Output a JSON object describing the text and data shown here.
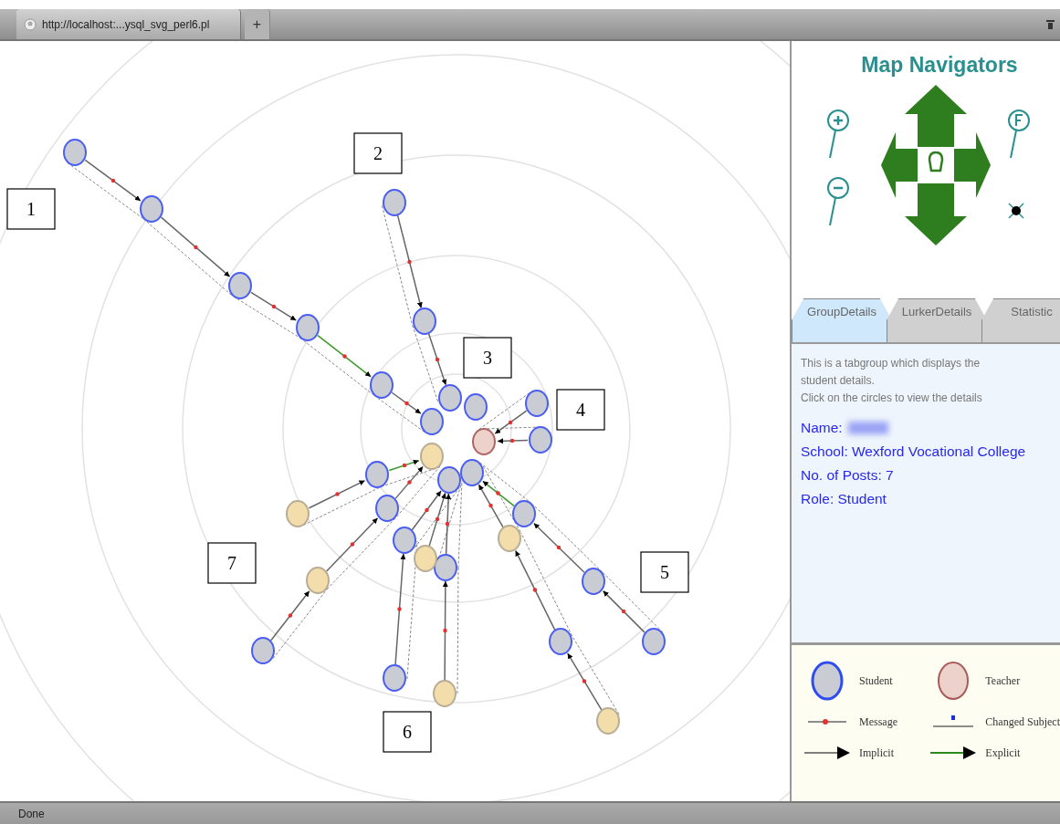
{
  "browser": {
    "tab_title": "http://localhost:...ysql_svg_perl6.pl",
    "new_tab": "+"
  },
  "map": {
    "nodes": [
      {
        "kind": "student"
      },
      {
        "kind": "student"
      },
      {
        "kind": "student"
      },
      {
        "kind": "student"
      },
      {
        "kind": "student"
      },
      {
        "kind": "student"
      },
      {
        "kind": "student"
      },
      {
        "kind": "student"
      },
      {
        "kind": "student"
      },
      {
        "kind": "student"
      },
      {
        "kind": "teacher"
      },
      {
        "kind": "student"
      },
      {
        "kind": "student"
      },
      {
        "kind": "other"
      },
      {
        "kind": "student"
      },
      {
        "kind": "student"
      },
      {
        "kind": "other"
      },
      {
        "kind": "student"
      },
      {
        "kind": "student"
      },
      {
        "kind": "student"
      },
      {
        "kind": "other"
      },
      {
        "kind": "student"
      },
      {
        "kind": "student"
      },
      {
        "kind": "student"
      },
      {
        "kind": "other"
      },
      {
        "kind": "student"
      },
      {
        "kind": "other"
      },
      {
        "kind": "student"
      },
      {
        "kind": "student"
      },
      {
        "kind": "other"
      },
      {
        "kind": "other"
      },
      {
        "kind": "student"
      }
    ],
    "edges": [
      {
        "kind": "implicit"
      },
      {
        "kind": "implicit"
      },
      {
        "kind": "implicit"
      },
      {
        "kind": "explicit"
      },
      {
        "kind": "implicit"
      },
      {
        "kind": "implicit"
      },
      {
        "kind": "implicit"
      },
      {
        "kind": "implicit"
      },
      {
        "kind": "implicit"
      },
      {
        "kind": "explicit"
      },
      {
        "kind": "implicit"
      },
      {
        "kind": "implicit"
      },
      {
        "kind": "implicit"
      },
      {
        "kind": "implicit"
      },
      {
        "kind": "implicit"
      },
      {
        "kind": "implicit"
      },
      {
        "kind": "implicit"
      },
      {
        "kind": "implicit"
      },
      {
        "kind": "implicit"
      },
      {
        "kind": "implicit"
      },
      {
        "kind": "explicit"
      },
      {
        "kind": "implicit"
      },
      {
        "kind": "implicit"
      },
      {
        "kind": "implicit"
      },
      {
        "kind": "implicit"
      }
    ],
    "labels": [
      "1",
      "2",
      "3",
      "4",
      "5",
      "6",
      "7"
    ]
  },
  "panel": {
    "title": "Map Navigators",
    "tabs": [
      {
        "label": "GroupDetails",
        "selected": true
      },
      {
        "label": "LurkerDetails",
        "selected": false
      },
      {
        "label": "Statistic",
        "selected": false
      }
    ],
    "description": [
      "This is a tabgroup which displays the",
      "student details.",
      "Click on the circles to view the details"
    ],
    "details": [
      {
        "text": "Name:",
        "redacted": true
      },
      {
        "text": "School: Wexford Vocational College",
        "redacted": false
      },
      {
        "text": "No. of Posts: 7",
        "redacted": false
      },
      {
        "text": "Role: Student",
        "redacted": false
      }
    ],
    "legend": [
      {
        "kind": "student",
        "label": "Student"
      },
      {
        "kind": "teacher",
        "label": "Teacher"
      },
      {
        "kind": "message",
        "label": "Message"
      },
      {
        "kind": "changed_subject",
        "label": "Changed Subject"
      },
      {
        "kind": "implicit",
        "label": "Implicit"
      },
      {
        "kind": "explicit",
        "label": "Explicit"
      }
    ]
  },
  "status_bar": "Done"
}
